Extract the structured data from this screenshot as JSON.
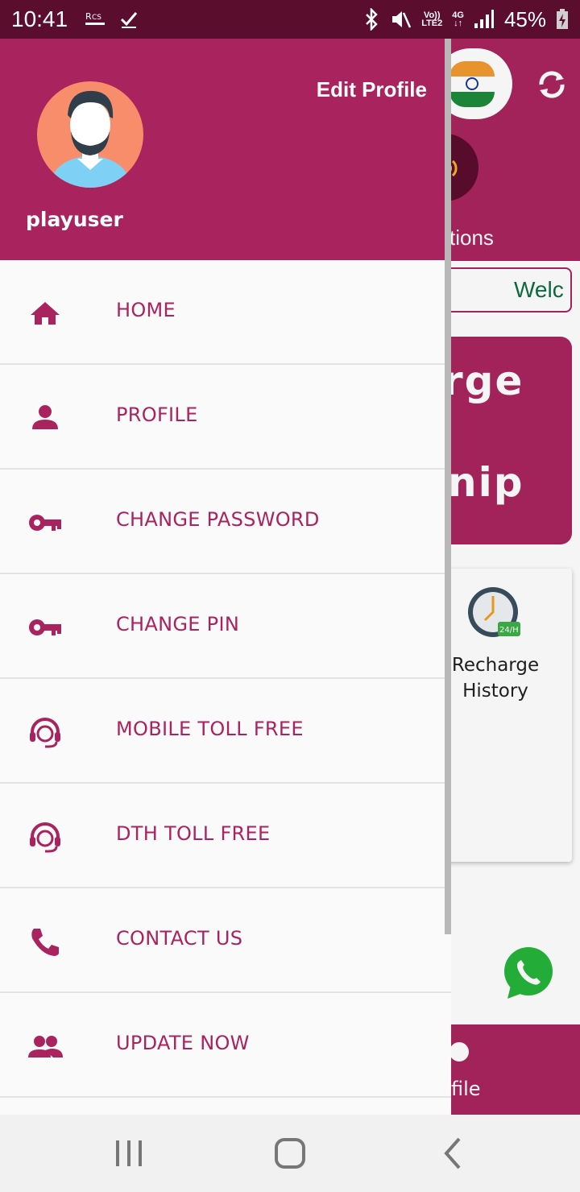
{
  "status_bar": {
    "time": "10:41",
    "left_icons": [
      "rcs-icon",
      "check-icon"
    ],
    "network_volte": "Vo))",
    "network_lte": "LTE2",
    "network_4g": "4G",
    "battery": "45%"
  },
  "drawer": {
    "edit_profile": "Edit Profile",
    "username": "playuser",
    "items": [
      {
        "label": "HOME",
        "icon": "home-icon"
      },
      {
        "label": "PROFILE",
        "icon": "person-icon"
      },
      {
        "label": "CHANGE PASSWORD",
        "icon": "key-icon"
      },
      {
        "label": "CHANGE PIN",
        "icon": "key-icon"
      },
      {
        "label": "MOBILE TOLL FREE",
        "icon": "headset-icon"
      },
      {
        "label": "DTH TOLL FREE",
        "icon": "headset-icon"
      },
      {
        "label": "CONTACT US",
        "icon": "phone-icon"
      },
      {
        "label": "UPDATE NOW",
        "icon": "group-icon"
      }
    ]
  },
  "background": {
    "notifications_partial": "tions",
    "welcome_partial": "Welc",
    "banner_line1": "rge",
    "banner_line2": "nip",
    "recharge_history": "Recharge History",
    "bottom_profile_partial": "file"
  },
  "colors": {
    "primary": "#a9245e",
    "status_bar": "#5b0d2e",
    "drawer_bg": "#fafafa"
  }
}
